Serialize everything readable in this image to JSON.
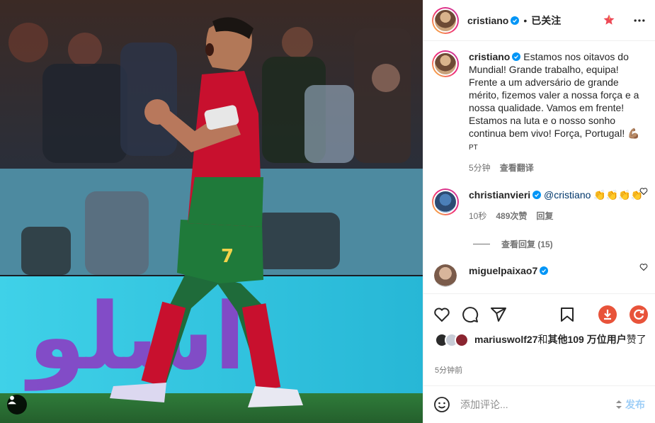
{
  "post": {
    "author": "cristiano",
    "follow_status": "已关注",
    "caption": "Estamos nos oitavos do Mundial! Grande trabalho, equipa! Frente a um adversário de grande mérito, fizemos valer a nossa força e a nossa qualidade. Vamos em frente! Estamos na luta e o nosso sonho continua bem vivo! Força, Portugal! 💪🏽",
    "caption_suffix": "PT",
    "caption_time": "5分钟",
    "see_translation": "查看翻译",
    "likes_text_user": "mariuswolf27",
    "likes_text_join": "和",
    "likes_text_others": "其他109 万位用户",
    "likes_text_end": "赞了",
    "time_ago": "5分钟前"
  },
  "comments": [
    {
      "username": "christianvieri",
      "text": "@cristiano 👏👏👏👏",
      "time": "10秒",
      "likes": "489次赞",
      "reply": "回复",
      "view_replies": "查看回复 (15)"
    },
    {
      "username": "miguelpaixao7",
      "text": "",
      "time": "",
      "likes": "",
      "reply": ""
    }
  ],
  "composer": {
    "placeholder": "添加评论...",
    "post_label": "发布"
  },
  "icons": {
    "verified": "verified-icon",
    "star": "favorite-star-icon",
    "more": "more-options-icon",
    "like": "heart-icon",
    "comment": "comment-icon",
    "share": "share-icon",
    "save": "bookmark-icon",
    "download": "download-icon",
    "refresh": "refresh-icon",
    "emoji": "emoji-icon",
    "user_tag": "user-tag-icon"
  },
  "colors": {
    "verified": "#0095f6",
    "star": "#ed4956",
    "download": "#e8533a",
    "post_disabled": "#9ecef7"
  }
}
